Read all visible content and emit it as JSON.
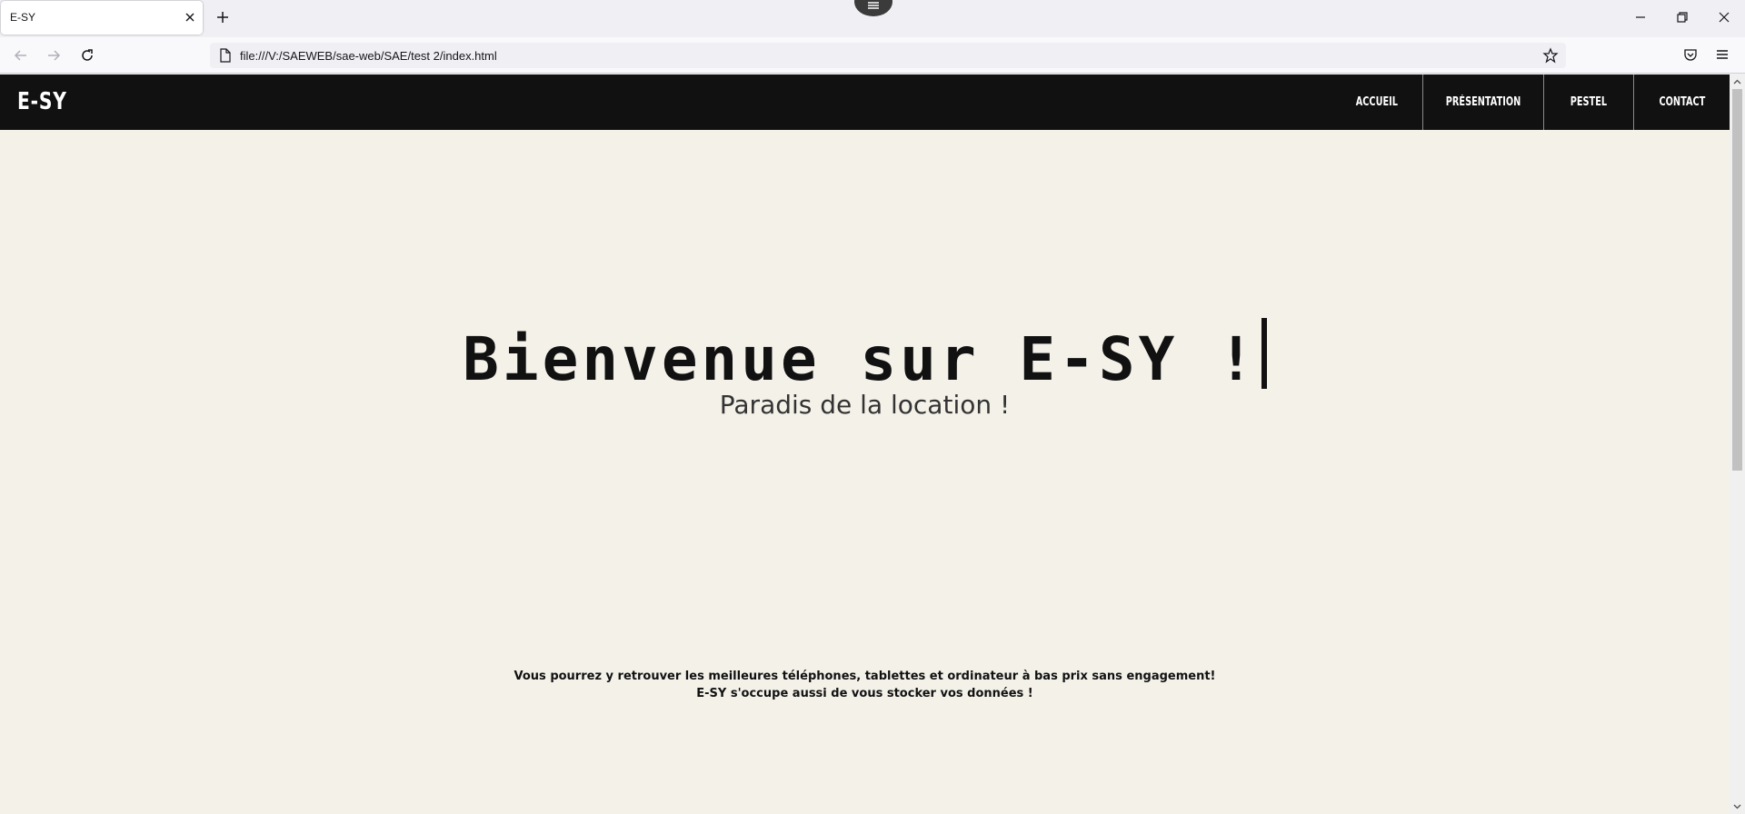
{
  "browser": {
    "tab_title": "E-SY",
    "url": "file:///V:/SAEWEB/sae-web/SAE/test 2/index.html",
    "icons": [
      "close-icon",
      "plus-icon",
      "menu-icon",
      "minimize-icon",
      "restore-icon",
      "window-close-icon",
      "back-arrow-icon",
      "forward-arrow-icon",
      "reload-icon",
      "document-icon",
      "star-icon",
      "pocket-icon",
      "hamburger-menu-icon"
    ]
  },
  "site": {
    "logo": "E-SY",
    "menu": [
      "ACCUEIL",
      "PRÉSENTATION",
      "PESTEL",
      "CONTACT"
    ],
    "hero_title": "Bienvenue sur E-SY !",
    "hero_subtitle": "Paradis de la location !",
    "info_line1": "Vous pourrez y retrouver les meilleures téléphones, tablettes et ordinateur à bas prix sans engagement!",
    "info_line2": "E-SY s'occupe aussi de vous stocker vos données !",
    "colors": {
      "header_bg": "#111111",
      "page_bg": "#f4f1e9",
      "text": "#111111"
    }
  }
}
